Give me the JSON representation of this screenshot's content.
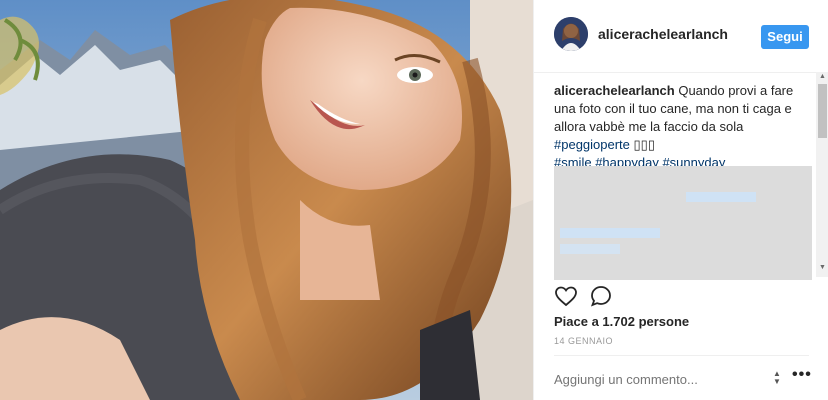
{
  "post": {
    "username": "alicerachelearlanch",
    "follow_label": "Segui",
    "caption_text": "Quando provi a fare una foto con il tuo cane, ma non ti caga e allora vabbè me la faccio da sola",
    "hashtags_line1": "#peggioperte",
    "emoji": "▯▯▯",
    "hashtags_line2": [
      "#smile",
      "#happyday",
      "#sunnyday"
    ],
    "likes_text": "Piace a 1.702 persone",
    "date": "14 GENNAIO",
    "comment_placeholder": "Aggiungi un commento...",
    "more_glyph": "•••"
  },
  "icons": {
    "like": "heart-outline-icon",
    "comment": "speech-bubble-icon",
    "options": "more-options-icon"
  },
  "colors": {
    "follow_bg": "#3897f0",
    "hashtag": "#003569",
    "text": "#262626",
    "muted": "#999999"
  }
}
